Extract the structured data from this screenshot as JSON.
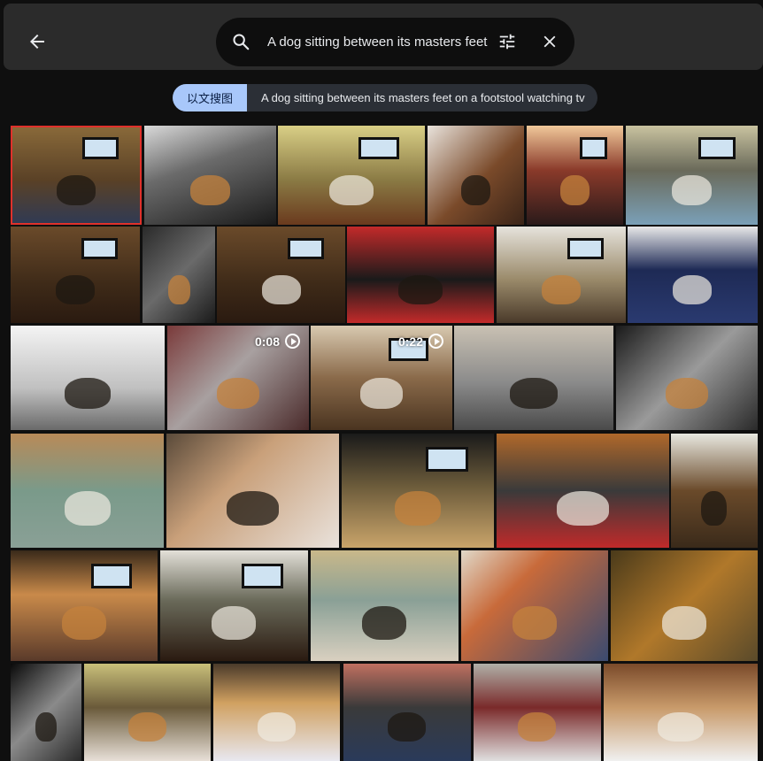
{
  "header": {
    "back_label": "Back",
    "search": {
      "value": "A dog sitting between its masters feet on a footstool watching tv",
      "placeholder": ""
    }
  },
  "chip": {
    "mode_label": "以文搜图",
    "query_text": "A dog sitting between its masters feet on a footstool watching tv"
  },
  "colors": {
    "accent": "#a8c7fa",
    "selected_border": "#e0312b",
    "background": "#0f0f0f",
    "topbar": "#2b2b2b"
  },
  "icons": [
    "back-arrow-icon",
    "search-icon",
    "tune-icon",
    "close-icon",
    "play-icon"
  ],
  "results": [
    {
      "id": "r1",
      "selected": true,
      "duration": ""
    },
    {
      "id": "r2",
      "selected": false,
      "duration": ""
    },
    {
      "id": "r3",
      "selected": false,
      "duration": ""
    },
    {
      "id": "r4",
      "selected": false,
      "duration": ""
    },
    {
      "id": "r5",
      "selected": false,
      "duration": ""
    },
    {
      "id": "r6",
      "selected": false,
      "duration": ""
    },
    {
      "id": "r7",
      "selected": false,
      "duration": ""
    },
    {
      "id": "r8",
      "selected": false,
      "duration": ""
    },
    {
      "id": "r9",
      "selected": false,
      "duration": ""
    },
    {
      "id": "r10",
      "selected": false,
      "duration": ""
    },
    {
      "id": "r11",
      "selected": false,
      "duration": ""
    },
    {
      "id": "r12",
      "selected": false,
      "duration": ""
    },
    {
      "id": "r13",
      "selected": false,
      "duration": ""
    },
    {
      "id": "r14",
      "selected": false,
      "duration": "0:08"
    },
    {
      "id": "r15",
      "selected": false,
      "duration": "0:22"
    },
    {
      "id": "r16",
      "selected": false,
      "duration": ""
    },
    {
      "id": "r17",
      "selected": false,
      "duration": ""
    },
    {
      "id": "r18",
      "selected": false,
      "duration": ""
    },
    {
      "id": "r19",
      "selected": false,
      "duration": ""
    },
    {
      "id": "r20",
      "selected": false,
      "duration": ""
    },
    {
      "id": "r21",
      "selected": false,
      "duration": ""
    },
    {
      "id": "r22",
      "selected": false,
      "duration": ""
    },
    {
      "id": "r23",
      "selected": false,
      "duration": ""
    },
    {
      "id": "r24",
      "selected": false,
      "duration": ""
    },
    {
      "id": "r25",
      "selected": false,
      "duration": ""
    },
    {
      "id": "r26",
      "selected": false,
      "duration": ""
    },
    {
      "id": "r27",
      "selected": false,
      "duration": ""
    },
    {
      "id": "r28",
      "selected": false,
      "duration": ""
    },
    {
      "id": "r29",
      "selected": false,
      "duration": ""
    },
    {
      "id": "r30",
      "selected": false,
      "duration": ""
    },
    {
      "id": "r31",
      "selected": false,
      "duration": ""
    },
    {
      "id": "r32",
      "selected": false,
      "duration": ""
    },
    {
      "id": "r33",
      "selected": false,
      "duration": ""
    },
    {
      "id": "r34",
      "selected": false,
      "duration": ""
    }
  ]
}
